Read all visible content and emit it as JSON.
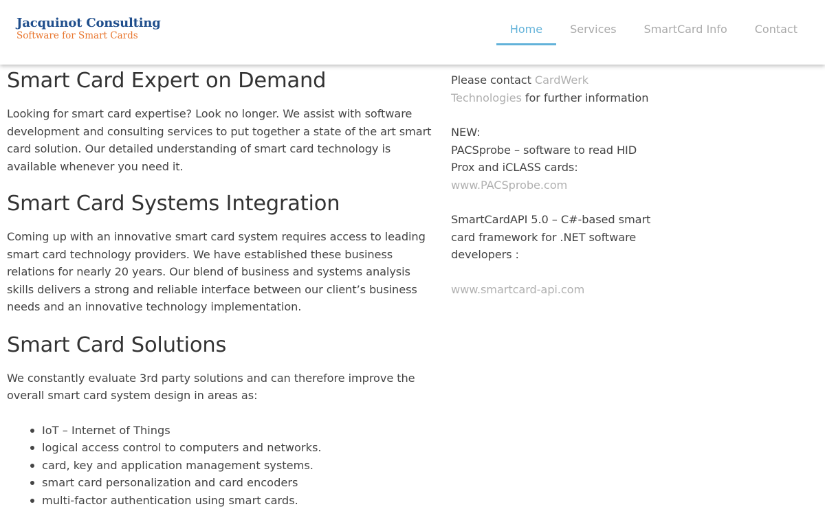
{
  "header": {
    "logo_title": "Jacquinot Consulting",
    "logo_subtitle": "Software for Smart Cards",
    "nav": {
      "home": "Home",
      "services": "Services",
      "smartcard_info": "SmartCard Info",
      "contact": "Contact"
    }
  },
  "main": {
    "section1": {
      "heading": "Smart Card Expert on Demand",
      "text": "Looking for smart card expertise? Look no longer. We assist with software development and consulting services to put together a state of the art smart card solution. Our detailed understanding of smart card technology is available whenever you need it."
    },
    "section2": {
      "heading": "Smart Card Systems Integration",
      "text": "Coming up with an innovative smart card system requires access to leading smart card technology providers. We have established these business relations for nearly 20 years. Our blend of business and systems analysis skills delivers a strong and reliable interface between our client’s business needs and an innovative technology implementation."
    },
    "section3": {
      "heading": "Smart Card Solutions",
      "text": "We constantly evaluate 3rd party solutions and can therefore improve the overall smart card system design in areas as:",
      "items": [
        "IoT – Internet of Things",
        "logical access control to computers and networks.",
        "card, key and application management systems.",
        "smart card personalization and card encoders",
        "multi-factor authentication using smart cards."
      ]
    }
  },
  "sidebar": {
    "contact_prefix": "Please contact",
    "contact_link": "CardWerk Technologies",
    "contact_suffix": "for further information",
    "new_label": "NEW:",
    "pacsprobe_text": "PACSprobe – software to read HID Prox and iCLASS cards:",
    "pacsprobe_link": "www.PACSprobe.com",
    "smartcardapi_text": "SmartCardAPI 5.0 – C#-based smart card framework for .NET software developers :",
    "smartcardapi_link": "www.smartcard-api.com"
  },
  "colors": {
    "accent": "#62b2d9",
    "logo_blue": "#1f4e8c",
    "logo_orange": "#e8742b",
    "link_gray": "#b0b0b0"
  }
}
